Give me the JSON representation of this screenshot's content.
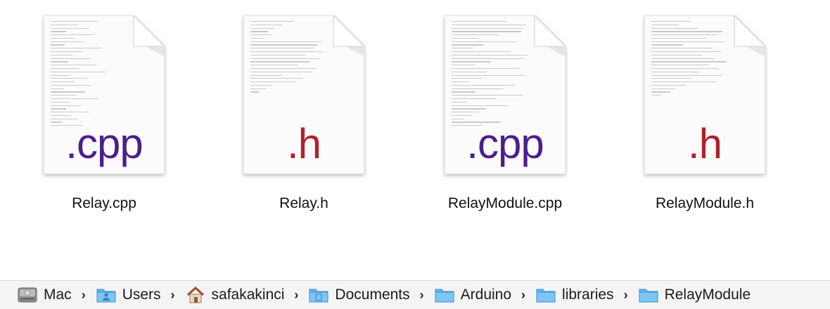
{
  "files": [
    {
      "name": "Relay.cpp",
      "extension": ".cpp",
      "icon": "cpp-file-icon",
      "ext_color": "#4b1e8c"
    },
    {
      "name": "Relay.h",
      "extension": ".h",
      "icon": "h-file-icon",
      "ext_color": "#b3202a"
    },
    {
      "name": "RelayModule.cpp",
      "extension": ".cpp",
      "icon": "cpp-file-icon",
      "ext_color": "#4b1e8c"
    },
    {
      "name": "RelayModule.h",
      "extension": ".h",
      "icon": "h-file-icon",
      "ext_color": "#b3202a"
    }
  ],
  "path_bar": {
    "items": [
      {
        "label": "Mac",
        "icon": "hard-drive-icon"
      },
      {
        "label": "Users",
        "icon": "users-folder-icon"
      },
      {
        "label": "safakakinci",
        "icon": "home-icon"
      },
      {
        "label": "Documents",
        "icon": "documents-folder-icon"
      },
      {
        "label": "Arduino",
        "icon": "folder-icon"
      },
      {
        "label": "libraries",
        "icon": "folder-icon"
      },
      {
        "label": "RelayModule",
        "icon": "folder-icon"
      }
    ],
    "separator": "›"
  },
  "colors": {
    "folder_blue": "#62b6ee",
    "background": "#ffffff",
    "path_bar_bg": "#f4f4f4"
  }
}
